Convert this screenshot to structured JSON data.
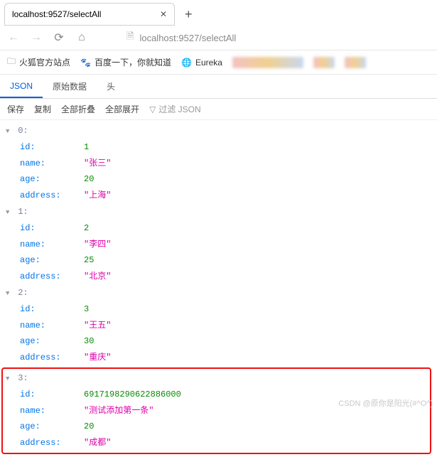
{
  "tab": {
    "title": "localhost:9527/selectAll"
  },
  "url": "localhost:9527/selectAll",
  "bookmarks": {
    "firefox": "火狐官方站点",
    "baidu": "百度一下，你就知道",
    "eureka": "Eureka"
  },
  "viewtabs": {
    "json": "JSON",
    "raw": "原始数据",
    "headers": "头"
  },
  "toolbar": {
    "save": "保存",
    "copy": "复制",
    "collapse_all": "全部折叠",
    "expand_all": "全部展开",
    "filter": "过滤 JSON"
  },
  "json": [
    {
      "index": "0:",
      "id": 1,
      "name": "\"张三\"",
      "age": 20,
      "address": "\"上海\""
    },
    {
      "index": "1:",
      "id": 2,
      "name": "\"李四\"",
      "age": 25,
      "address": "\"北京\""
    },
    {
      "index": "2:",
      "id": 3,
      "name": "\"王五\"",
      "age": 30,
      "address": "\"重庆\""
    },
    {
      "index": "3:",
      "id": 6917198290622886000,
      "name": "\"测试添加第一条\"",
      "age": 20,
      "address": "\"成都\""
    }
  ],
  "keys": {
    "id": "id:",
    "name": "name:",
    "age": "age:",
    "address": "address:"
  },
  "watermark": "CSDN @原你是阳光(#^O^)"
}
